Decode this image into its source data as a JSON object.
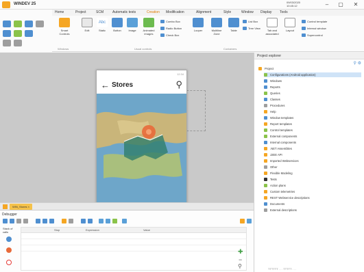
{
  "window": {
    "title": "WINDEV 25",
    "clock_lines": [
      "09/03/2020",
      "10:45:12"
    ],
    "controls": {
      "minimize": "–",
      "restore": "▢",
      "close": "✕"
    }
  },
  "ribbon": {
    "tabs": [
      "Home",
      "Project",
      "SCM",
      "Automatic tests",
      "Creation",
      "Modification",
      "Alignment",
      "Style",
      "Window",
      "Display",
      "Tools"
    ],
    "active_tab": "Creation",
    "buttons": [
      {
        "label": "Smart Controls"
      },
      {
        "label": "Edit"
      },
      {
        "label": "Static"
      },
      {
        "label": "Button"
      },
      {
        "label": "Image"
      },
      {
        "label": "Animated images"
      },
      {
        "label": "Looper"
      },
      {
        "label": "Multiline Zone"
      },
      {
        "label": "Table"
      },
      {
        "label": "Tab and associated"
      },
      {
        "label": "Layout"
      }
    ],
    "small_items": [
      "Combo Box",
      "Radio Button",
      "Check Box",
      "List Box",
      "Tree View",
      "Control template",
      "Internal window",
      "Supercontrol"
    ],
    "groups": [
      "Windows",
      "Usual controls",
      "Containers"
    ]
  },
  "phone": {
    "time": "12:34",
    "title": "Stores",
    "back_glyph": "←",
    "search_glyph": "⚲"
  },
  "doc_tab": {
    "label": "WIN_Stores ×"
  },
  "debugger": {
    "title": "Debugger",
    "left_header": "Stack of calls",
    "columns": [
      "Stop",
      "Expression",
      "Value"
    ]
  },
  "explorer": {
    "title": "Project explorer",
    "items": [
      {
        "label": "Project",
        "level": 0,
        "color": "#f5a623"
      },
      {
        "label": "Configurations (Android application)",
        "level": 1,
        "color": "#8bc34a",
        "selected": true
      },
      {
        "label": "Windows",
        "level": 1,
        "color": "#4f8fd0"
      },
      {
        "label": "Reports",
        "level": 1,
        "color": "#4f8fd0"
      },
      {
        "label": "Queries",
        "level": 1,
        "color": "#8bc34a"
      },
      {
        "label": "Classes",
        "level": 1,
        "color": "#4f8fd0"
      },
      {
        "label": "Procedures",
        "level": 1,
        "color": "#9e9e9e"
      },
      {
        "label": "Help",
        "level": 1,
        "color": "#f5a623"
      },
      {
        "label": "Window templates",
        "level": 1,
        "color": "#4f8fd0"
      },
      {
        "label": "Report templates",
        "level": 1,
        "color": "#f5a623"
      },
      {
        "label": "Control templates",
        "level": 1,
        "color": "#8bc34a"
      },
      {
        "label": "External components",
        "level": 1,
        "color": "#8bc34a"
      },
      {
        "label": "Internal components",
        "level": 1,
        "color": "#4f8fd0"
      },
      {
        "label": ".NET Assemblies",
        "level": 1,
        "color": "#f5a623"
      },
      {
        "label": "J2EE API",
        "level": 1,
        "color": "#f5a623"
      },
      {
        "label": "Imported Webservices",
        "level": 1,
        "color": "#f5a623"
      },
      {
        "label": "Other",
        "level": 1,
        "color": "#9e9e9e"
      },
      {
        "label": "Flexible Modeling",
        "level": 1,
        "color": "#f5a623"
      },
      {
        "label": "Tests",
        "level": 1,
        "color": "#333333"
      },
      {
        "label": "Action plans",
        "level": 1,
        "color": "#8bc34a"
      },
      {
        "label": "Custom telemetries",
        "level": 1,
        "color": "#f5a623"
      },
      {
        "label": "REST Webservice descriptions",
        "level": 1,
        "color": "#f5a623"
      },
      {
        "label": "Documents",
        "level": 1,
        "color": "#4f8fd0"
      },
      {
        "label": "External descriptions",
        "level": 1,
        "color": "#9e9e9e"
      }
    ],
    "status": "TTTTTT  . . .  TTTTT  . . ."
  },
  "colors": {
    "accent": "#f5a623",
    "selection": "#cfe3f7",
    "map_water": "#6ea6c9",
    "marker": "#e86a3a"
  }
}
